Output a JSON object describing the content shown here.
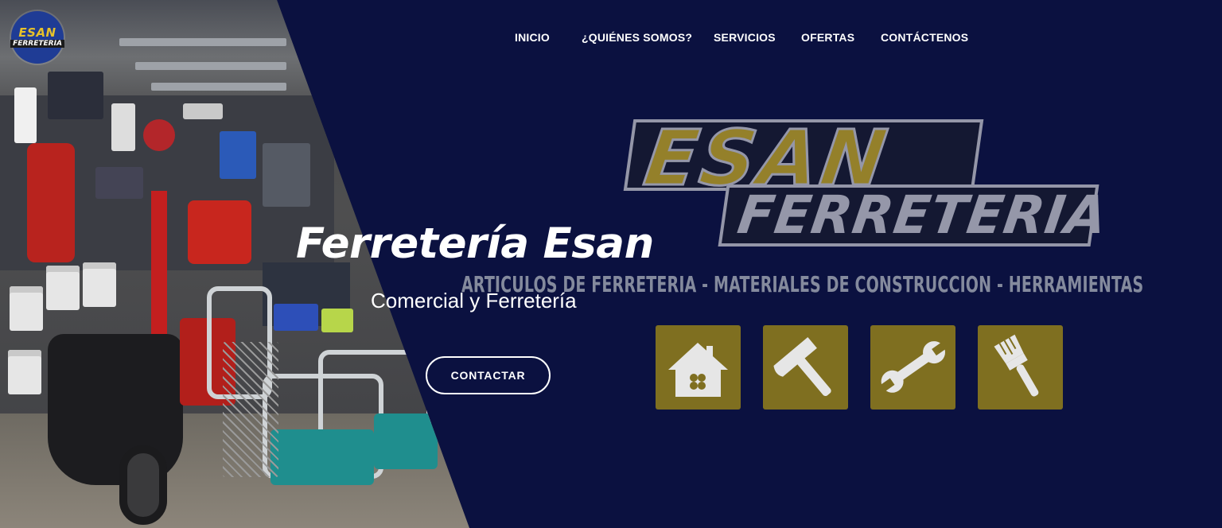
{
  "logo": {
    "line1": "ESAN",
    "line2": "FERRETERIA"
  },
  "nav": {
    "items": [
      {
        "label": "INICIO"
      },
      {
        "label": "¿QUIÉNES SOMOS?"
      },
      {
        "label": "SERVICIOS"
      },
      {
        "label": "OFERTAS"
      },
      {
        "label": "CONTÁCTENOS"
      }
    ]
  },
  "hero": {
    "title": "Ferretería Esan",
    "subtitle": "Comercial y Ferretería",
    "cta_label": "CONTACTAR"
  },
  "brand_banner": {
    "line1": "ESAN",
    "line2": "FERRETERIA",
    "tagline": "ARTICULOS DE FERRETERIA - MATERIALES DE CONSTRUCCION - HERRAMIENTAS",
    "icons": [
      "house-icon",
      "hammer-icon",
      "wrench-icon",
      "paintbrush-icon"
    ]
  },
  "colors": {
    "background": "#0b1140",
    "accent_gold": "#e8c41e",
    "tile": "#7f6f20",
    "text": "#ffffff"
  }
}
